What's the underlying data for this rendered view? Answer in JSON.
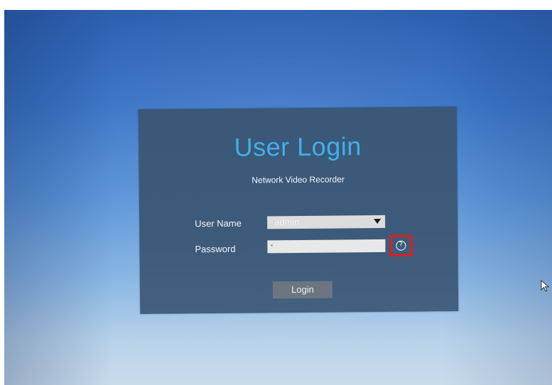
{
  "dialog": {
    "title": "User Login",
    "subtitle": "Network Video Recorder",
    "username_label": "User Name",
    "username_value": "admin",
    "password_label": "Password",
    "password_value": "·",
    "help_icon": "question-circle",
    "help_highlight_color": "#e21b1b",
    "login_label": "Login"
  },
  "colors": {
    "title": "#3fb0e8",
    "dialog_bg": "#3d5a7a",
    "button_bg": "#6d7580"
  },
  "pointer": "mouse-cursor-icon"
}
